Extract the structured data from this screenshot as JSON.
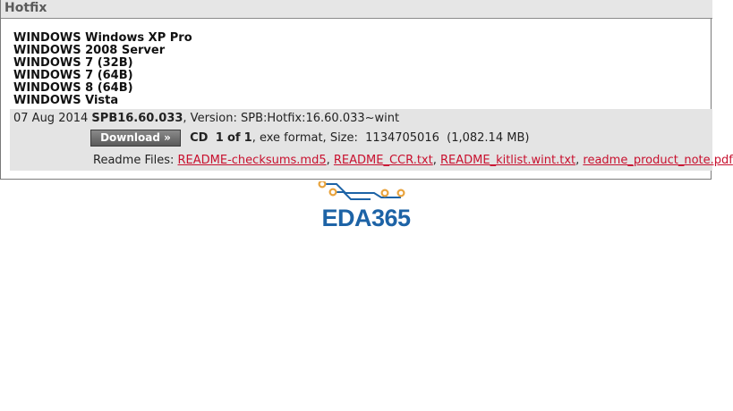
{
  "panel": {
    "title": "Hotfix",
    "os_list": [
      "WINDOWS Windows XP Pro",
      "WINDOWS 2008 Server",
      "WINDOWS 7 (32B)",
      "WINDOWS 7 (64B)",
      "WINDOWS 8 (64B)",
      "WINDOWS Vista"
    ]
  },
  "release": {
    "date": "07 Aug 2014",
    "name": "SPB16.60.033",
    "version_label": ", Version: SPB:Hotfix:16.60.033~wint",
    "download_label": "Download »",
    "cd_label": "CD",
    "cd_index": "1",
    "of_label": "of",
    "cd_total": "1",
    "format_label": ",  exe format, Size:",
    "size_bytes": "1134705016",
    "size_readable": "(1,082.14 MB)",
    "readme_label": "Readme Files:",
    "readme_files": [
      "README-checksums.md5",
      "README_CCR.txt",
      "README_kitlist.wint.txt",
      "readme_product_note.pdf"
    ]
  },
  "logo": {
    "text": "EDA365",
    "colors": {
      "circuit": "#e8a33d",
      "trace": "#1d63a6",
      "text": "#1d63a6"
    }
  }
}
